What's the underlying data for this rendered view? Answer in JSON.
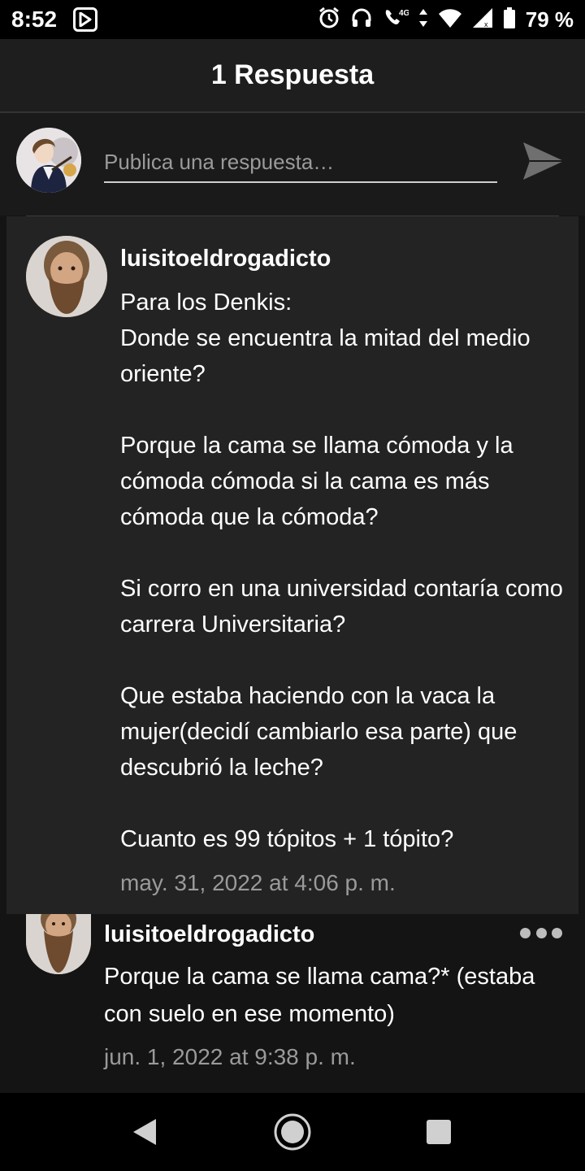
{
  "status_bar": {
    "time": "8:52",
    "battery": "79 %",
    "icons": [
      "play-store-icon",
      "alarm-icon",
      "headphones-icon",
      "volte-4g-icon",
      "data-arrows-icon",
      "wifi-icon",
      "signal-icon",
      "battery-icon"
    ]
  },
  "header": {
    "title": "1 Respuesta"
  },
  "composer": {
    "placeholder": "Publica una respuesta…",
    "send_icon": "send-icon"
  },
  "main_comment": {
    "username": "luisitoeldrogadicto",
    "paragraphs": [
      "Para los Denkis:\nDonde se encuentra la mitad del medio oriente?",
      "Porque la cama se llama cómoda y la cómoda cómoda si la cama es más cómoda que la cómoda?",
      "Si corro en una universidad contaría como carrera Universitaria?",
      "Que estaba haciendo con la vaca la mujer(decidí cambiarlo esa parte) que descubrió la leche?",
      "Cuanto es 99 tópitos + 1 tópito?"
    ],
    "date": "may. 31, 2022 at 4:06 p. m."
  },
  "reply": {
    "username": "luisitoeldrogadicto",
    "text": "Porque la cama se llama cama?* (estaba con suelo en ese momento)",
    "date": "jun. 1, 2022 at 9:38 p. m.",
    "more_icon": "more-dots-icon"
  },
  "nav_bar": {
    "buttons": [
      "back-icon",
      "home-icon",
      "recents-icon"
    ]
  },
  "colors": {
    "background": "#141414",
    "card": "#232323",
    "header": "#1e1e1e",
    "muted_text": "#9a9a9a"
  }
}
